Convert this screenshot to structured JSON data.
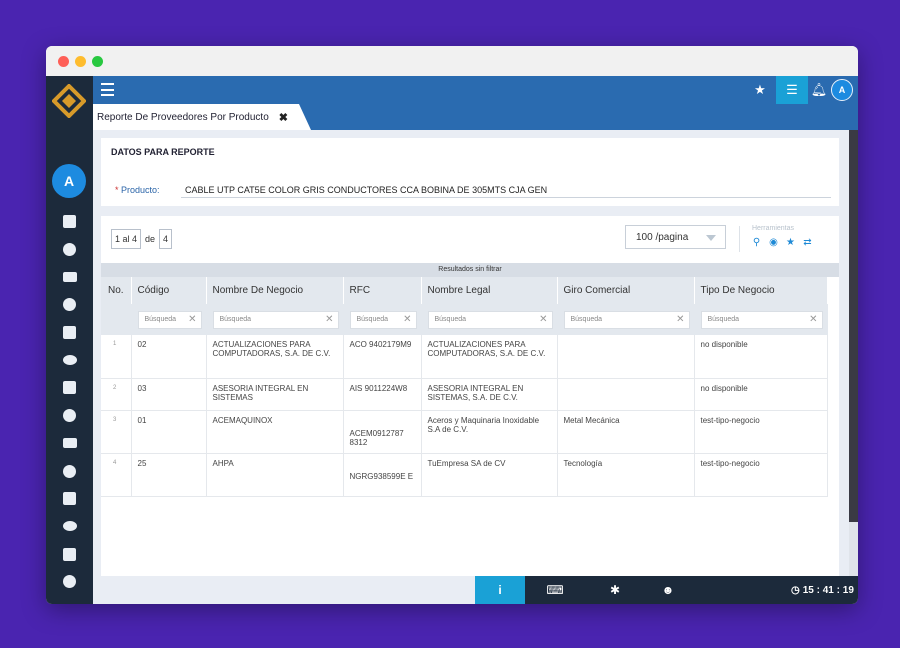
{
  "window": {
    "tab_title": "Reporte De Proveedores Por Producto",
    "tab_close": "✖"
  },
  "user": {
    "initial": "A"
  },
  "topbar": {
    "icons": [
      "star-icon",
      "sliders-icon",
      "bell-icon",
      "chat-icon"
    ]
  },
  "sidebar": {
    "icons": [
      "tree-icon",
      "users-icon",
      "building-icon",
      "truck-icon",
      "box-icon",
      "clipboard-icon",
      "money-icon",
      "org-icon",
      "calc-icon",
      "people-icon",
      "document-icon",
      "hand-icon",
      "delivery-icon",
      "chart-icon",
      "pin-icon",
      "gauge-icon"
    ]
  },
  "datos": {
    "heading": "DATOS PARA REPORTE",
    "product_required": "*",
    "product_label": "Producto:",
    "product_value": "CABLE UTP CAT5E COLOR GRIS CONDUCTORES CCA BOBINA DE 305MTS CJA GEN"
  },
  "pager": {
    "range": "1 al 4",
    "of": "de",
    "total": "4"
  },
  "perpage": {
    "value": "100 /pagina"
  },
  "tools": {
    "label": "Herramientas",
    "icons": [
      "search-icon",
      "eye-icon",
      "star-icon",
      "refresh-icon"
    ]
  },
  "results_label": "Resultados sin filtrar",
  "table": {
    "headers": {
      "no": "No.",
      "codigo": "Código",
      "nombre": "Nombre De Negocio",
      "rfc": "RFC",
      "legal": "Nombre Legal",
      "giro": "Giro Comercial",
      "tipo": "Tipo De Negocio"
    },
    "filter_placeholder": "Búsqueda",
    "filter_clear": "✕",
    "rows": [
      {
        "no": "1",
        "codigo": "02",
        "nombre": "ACTUALIZACIONES PARA COMPUTADORAS, S.A. DE C.V.",
        "rfc": "ACO 9402179M9",
        "legal": "ACTUALIZACIONES PARA COMPUTADORAS, S.A. DE C.V.",
        "giro": "",
        "tipo": "no disponible"
      },
      {
        "no": "2",
        "codigo": "03",
        "nombre": "ASESORIA INTEGRAL EN SISTEMAS",
        "rfc": "AIS 9011224W8",
        "legal": "ASESORIA INTEGRAL EN SISTEMAS, S.A. DE C.V.",
        "giro": "",
        "tipo": "no disponible"
      },
      {
        "no": "3",
        "codigo": "01",
        "nombre": "ACEMAQUINOX",
        "rfc": "ACEM0912787 8312",
        "legal": "Aceros y Maquinaria Inoxidable S.A de C.V.",
        "giro": "Metal Mecánica",
        "tipo": "test-tipo-negocio"
      },
      {
        "no": "4",
        "codigo": "25",
        "nombre": "AHPA",
        "rfc": "NGRG938599E E",
        "legal": "TuEmpresa SA de CV",
        "giro": "Tecnología",
        "tipo": "test-tipo-negocio"
      }
    ]
  },
  "statusbar": {
    "info": "i",
    "clock": "15 : 41 : 19",
    "clock_icon": "◷"
  }
}
